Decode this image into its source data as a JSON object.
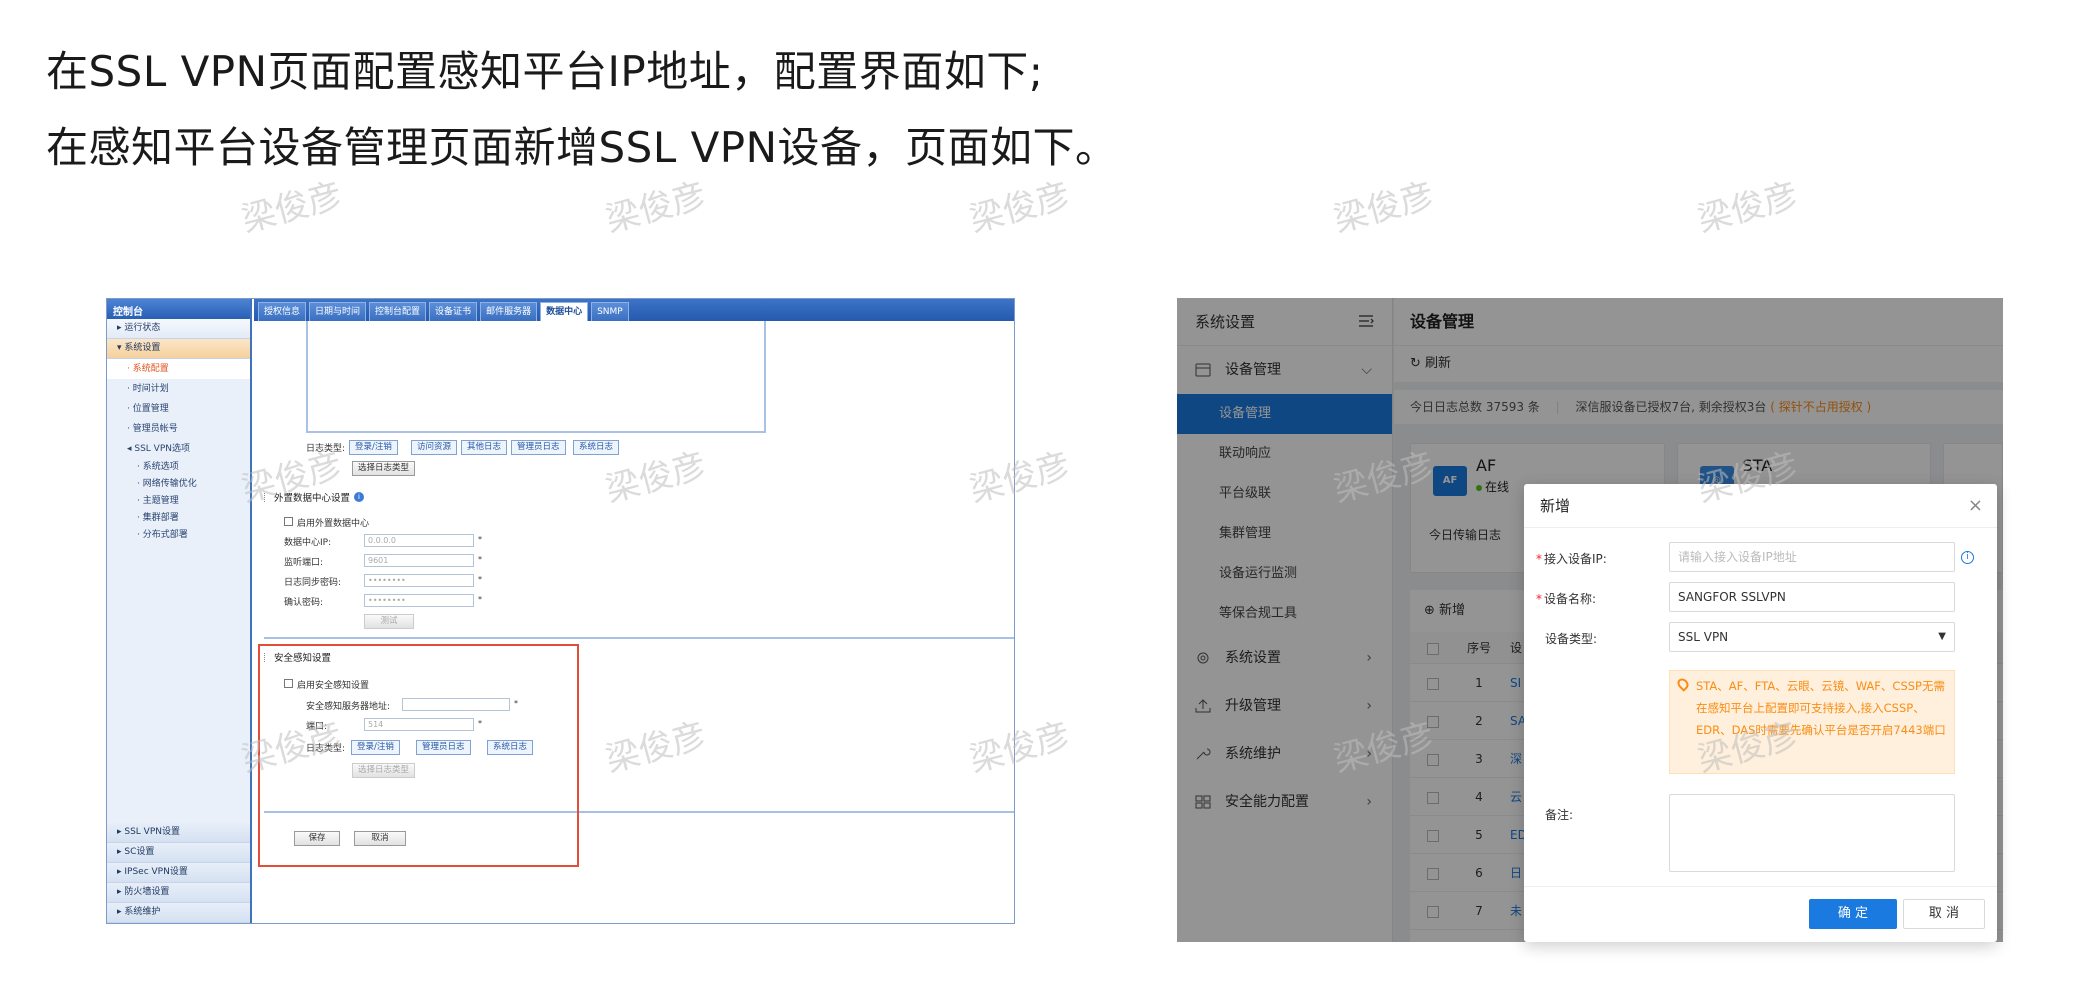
{
  "headline": {
    "line1": "在SSL VPN页面配置感知平台IP地址，配置界面如下;",
    "line2": "在感知平台设备管理页面新增SSL VPN设备，页面如下。"
  },
  "watermark": "梁俊彦",
  "ssl_vpn_console": {
    "sidebar_title": "控制台",
    "sidebar_items": [
      {
        "label": "▸ 运行状态"
      },
      {
        "label": "▾ 系统设置"
      }
    ],
    "system_sub": [
      {
        "label": "· 系统配置",
        "active": true
      },
      {
        "label": "· 时间计划",
        "active": false
      },
      {
        "label": "· 位置管理",
        "active": false
      },
      {
        "label": "· 管理员帐号",
        "active": false
      },
      {
        "label": "◂ SSL VPN选项",
        "active": false
      }
    ],
    "sslvpn_sub": [
      "· 系统选项",
      "· 网络传输优化",
      "· 主题管理",
      "· 集群部署",
      "· 分布式部署"
    ],
    "bottom_items": [
      "▸ SSL VPN设置",
      "▸ SC设置",
      "▸ IPSec VPN设置",
      "▸ 防火墙设置",
      "▸ 系统维护"
    ],
    "tabs": [
      {
        "label": "授权信息",
        "active": false
      },
      {
        "label": "日期与时间",
        "active": false
      },
      {
        "label": "控制台配置",
        "active": false
      },
      {
        "label": "设备证书",
        "active": false
      },
      {
        "label": "邮件服务器",
        "active": false
      },
      {
        "label": "数据中心",
        "active": true
      },
      {
        "label": "SNMP",
        "active": false
      }
    ],
    "log_type_label": "日志类型:",
    "log_chips_top": [
      "登录/注销",
      "访问资源",
      "其他日志",
      "管理员日志",
      "系统日志"
    ],
    "select_log_type": "选择日志类型",
    "external_dc": {
      "title": "外置数据中心设置",
      "enable": "启用外置数据中心",
      "ip_label": "数据中心IP:",
      "ip_value": "0.0.0.0",
      "port_label": "监听端口:",
      "port_value": "9601",
      "sync_pwd_label": "日志同步密码:",
      "sync_pwd_value": "••••••••",
      "confirm_pwd_label": "确认密码:",
      "confirm_pwd_value": "••••••••",
      "test_button": "测试"
    },
    "security_awareness": {
      "title": "安全感知设置",
      "enable": "启用安全感知设置",
      "server_label": "安全感知服务器地址:",
      "server_value": "",
      "port_label": "端口:",
      "port_value": "514",
      "log_type_label": "日志类型:",
      "log_chips": [
        "登录/注销",
        "管理员日志",
        "系统日志"
      ],
      "select_log_type": "选择日志类型"
    },
    "save_button": "保存",
    "cancel_button": "取消",
    "required_mark": "*"
  },
  "awareness_platform": {
    "sidebar_title": "系统设置",
    "device_mgmt_group": "设备管理",
    "device_mgmt_sub": [
      {
        "label": "设备管理",
        "active": true
      },
      {
        "label": "联动响应",
        "active": false
      },
      {
        "label": "平台级联",
        "active": false
      },
      {
        "label": "集群管理",
        "active": false
      },
      {
        "label": "设备运行监测",
        "active": false
      },
      {
        "label": "等保合规工具",
        "active": false
      }
    ],
    "other_groups": [
      "系统设置",
      "升级管理",
      "系统维护",
      "安全能力配置"
    ],
    "page_title": "设备管理",
    "refresh": "刷新",
    "stats_left": "今日日志总数 37593 条",
    "stats_right": "深信服设备已授权7台, 剩余授权3台",
    "stats_warn": "( 探针不占用授权 )",
    "cards": [
      {
        "icon": "AF",
        "name": "AF",
        "status": "在线",
        "log_label": "今日传输日志"
      },
      {
        "icon": "STA",
        "name": "STA",
        "status": "",
        "log_label": ""
      }
    ],
    "table_add": "新增",
    "table_headers": {
      "index": "序号",
      "name": "设"
    },
    "table_rows": [
      {
        "index": "1",
        "name": "SI"
      },
      {
        "index": "2",
        "name": "SA"
      },
      {
        "index": "3",
        "name": "深"
      },
      {
        "index": "4",
        "name": "云"
      },
      {
        "index": "5",
        "name": "ED"
      },
      {
        "index": "6",
        "name": "日"
      },
      {
        "index": "7",
        "name": "未"
      }
    ]
  },
  "modal": {
    "title": "新增",
    "close": "×",
    "ip_label": "接入设备IP:",
    "ip_placeholder": "请输入接入设备IP地址",
    "name_label": "设备名称:",
    "name_value": "SANGFOR SSLVPN",
    "type_label": "设备类型:",
    "type_value": "SSL VPN",
    "note": "STA、AF、FTA、云眼、云镜、WAF、CSSP无需在感知平台上配置即可支持接入,接入CSSP、EDR、DAS时需要先确认平台是否开启7443端口",
    "remark_label": "备注:",
    "ok_button": "确 定",
    "cancel_button": "取 消",
    "required_mark": "*"
  }
}
